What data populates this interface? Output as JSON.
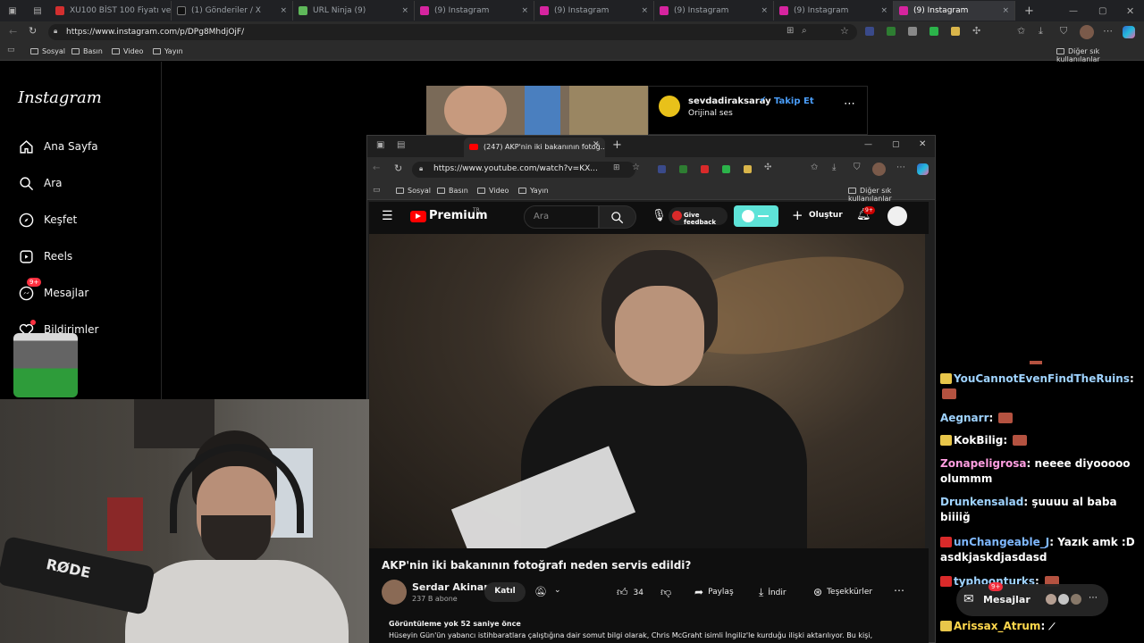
{
  "outer_tabs": [
    {
      "label": "XU100 BİST 100 Fiyatı ve...",
      "color": "#d32f2f"
    },
    {
      "label": "(1) Gönderiler / X",
      "color": "#000000"
    },
    {
      "label": "URL Ninja (9)",
      "color": "#5fb85a"
    },
    {
      "label": "(9) Instagram",
      "color": "#d6249f"
    },
    {
      "label": "(9) Instagram",
      "color": "#d6249f"
    },
    {
      "label": "(9) Instagram",
      "color": "#d6249f"
    },
    {
      "label": "(9) Instagram",
      "color": "#d6249f"
    },
    {
      "label": "(9) Instagram",
      "color": "#d6249f"
    }
  ],
  "outer_url": "https://www.instagram.com/p/DPg8MhdjOjF/",
  "outer_bookmarks": [
    "Sosyal",
    "Basın",
    "Video",
    "Yayın"
  ],
  "outer_bookmarks_other": "Diğer sık kullanılanlar",
  "instagram": {
    "logo": "Instagram",
    "nav": [
      "Ana Sayfa",
      "Ara",
      "Keşfet",
      "Reels",
      "Mesajlar",
      "Bildirimler"
    ],
    "messages_badge": "9+",
    "post_user": "sevdadiraksaray",
    "post_follow": "Takip Et",
    "post_audio": "Orijinal ses",
    "dm_label": "Mesajlar",
    "dm_badge": "9+"
  },
  "youtube_window": {
    "tab_title": "(247) AKP'nin iki bakanının fotoğ...",
    "url": "https://www.youtube.com/watch?v=KX...",
    "bookmarks": [
      "Sosyal",
      "Basın",
      "Video",
      "Yayın"
    ],
    "bookmarks_other": "Diğer sık kullanılanlar",
    "logo": "Premium",
    "logo_region": "TR",
    "search_placeholder": "Ara",
    "feedback": "Give feedback",
    "create": "Oluştur",
    "notif_badge": "9+",
    "video_title": "AKP'nin iki bakanının fotoğrafı neden servis edildi?",
    "channel": "Serdar Akinan",
    "subscribers": "237 B abone",
    "join": "Katıl",
    "likes": "34",
    "share": "Paylaş",
    "download": "İndir",
    "thanks": "Teşekkürler",
    "views": "Görüntüleme yok  52 saniye önce",
    "description": "Hüseyin Gün'ün yabancı istihbaratlara çalıştığına dair somut bilgi olarak, Chris McGraht isimli İngiliz'le kurduğu ilişki aktarılıyor. Bu kişi,"
  },
  "chat": [
    {
      "user": "YouCannotEvenFindTheRuins",
      "text": "",
      "color": "#9fd3ff",
      "badge": "y"
    },
    {
      "user": "Aegnarr",
      "text": "",
      "color": "#9fd3ff",
      "badge": ""
    },
    {
      "user": "KokBilig",
      "text": "",
      "color": "#ffffff",
      "badge": "y"
    },
    {
      "user": "Zonapeligrosa",
      "text": "neeee diyooooo olummm",
      "color": "#ff9ee0",
      "badge": ""
    },
    {
      "user": "Drunkensalad",
      "text": "şuuuu al baba biiiiğ",
      "color": "#9fd3ff",
      "badge": ""
    },
    {
      "user": "unChangeable_J",
      "text": "Yazık amk :D asdkjaskdjasdasd",
      "color": "#7fb8ff",
      "badge": "r"
    },
    {
      "user": "typhoonturks",
      "text": "",
      "color": "#9fd3ff",
      "badge": "r"
    },
    {
      "user": "Arissax_Atrum",
      "text": "",
      "color": "#ffd84d",
      "badge": "y"
    }
  ],
  "colors": {
    "yt_red": "#ff0000",
    "ig_badge": "#ff3040",
    "follow_blue": "#4a9df8",
    "toggle": "#5ee3d8"
  }
}
